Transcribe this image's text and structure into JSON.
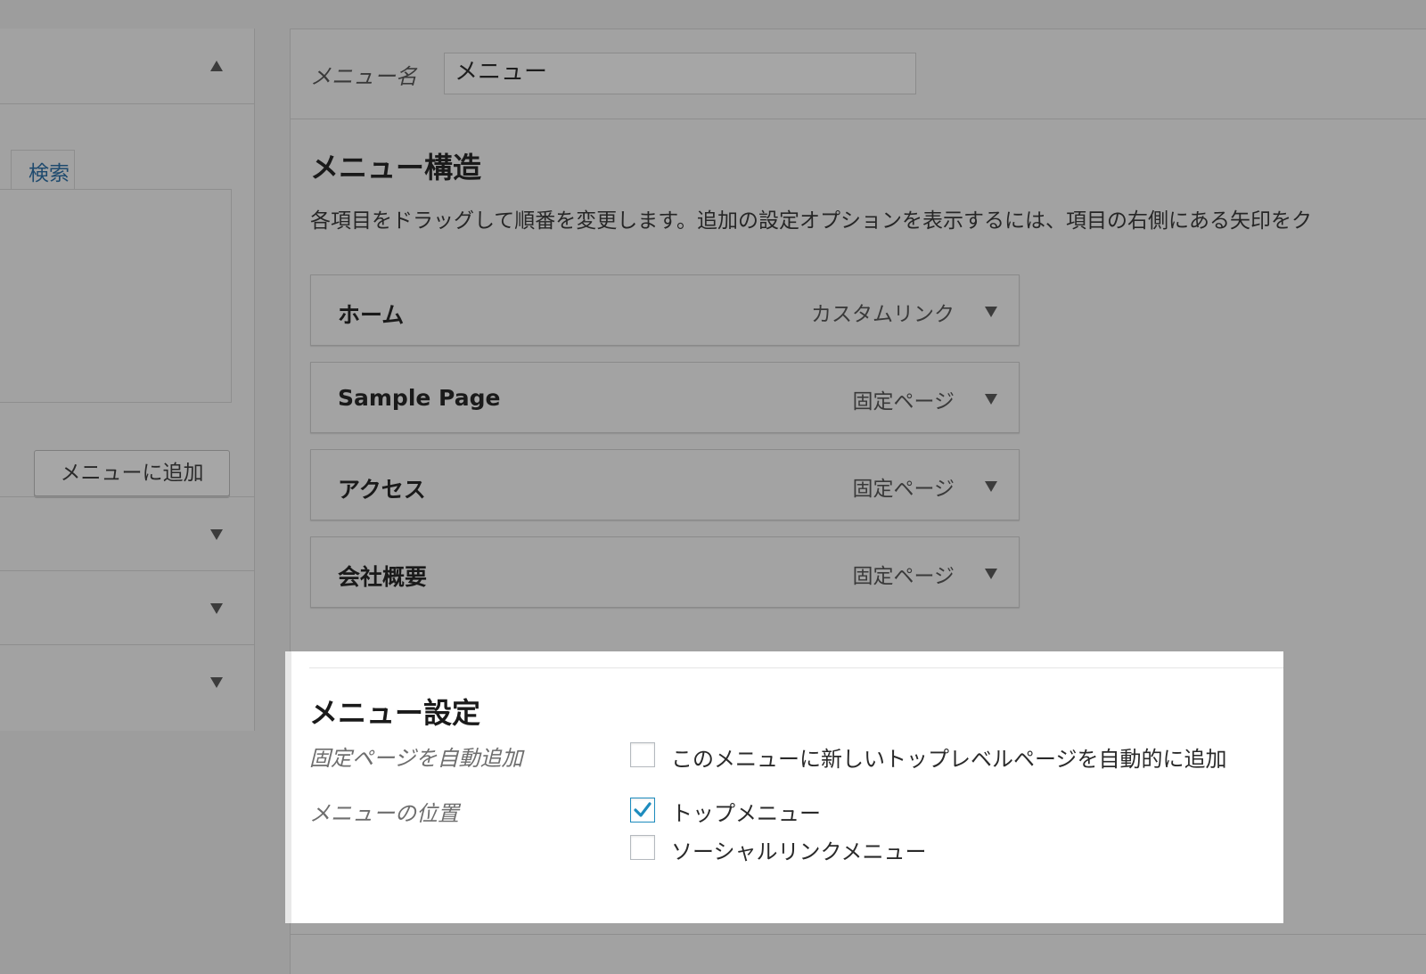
{
  "left": {
    "search_tab_label": "検索",
    "add_button_label": "メニューに追加"
  },
  "menu": {
    "name_label": "メニュー名",
    "name_value": "メニュー"
  },
  "structure": {
    "title": "メニュー構造",
    "description": "各項目をドラッグして順番を変更します。追加の設定オプションを表示するには、項目の右側にある矢印をク",
    "items": [
      {
        "title": "ホーム",
        "type": "カスタムリンク"
      },
      {
        "title": "Sample Page",
        "type": "固定ページ"
      },
      {
        "title": "アクセス",
        "type": "固定ページ"
      },
      {
        "title": "会社概要",
        "type": "固定ページ"
      }
    ]
  },
  "settings": {
    "title": "メニュー設定",
    "auto_add_label": "固定ページを自動追加",
    "auto_add_option": "このメニューに新しいトップレベルページを自動的に追加",
    "auto_add_checked": false,
    "location_label": "メニューの位置",
    "locations": [
      {
        "label": "トップメニュー",
        "checked": true
      },
      {
        "label": "ソーシャルリンクメニュー",
        "checked": false
      }
    ]
  },
  "colors": {
    "checkbox_check": "#1e8cbe",
    "link": "#1e4a6e",
    "highlight_background": "#ffffff"
  }
}
